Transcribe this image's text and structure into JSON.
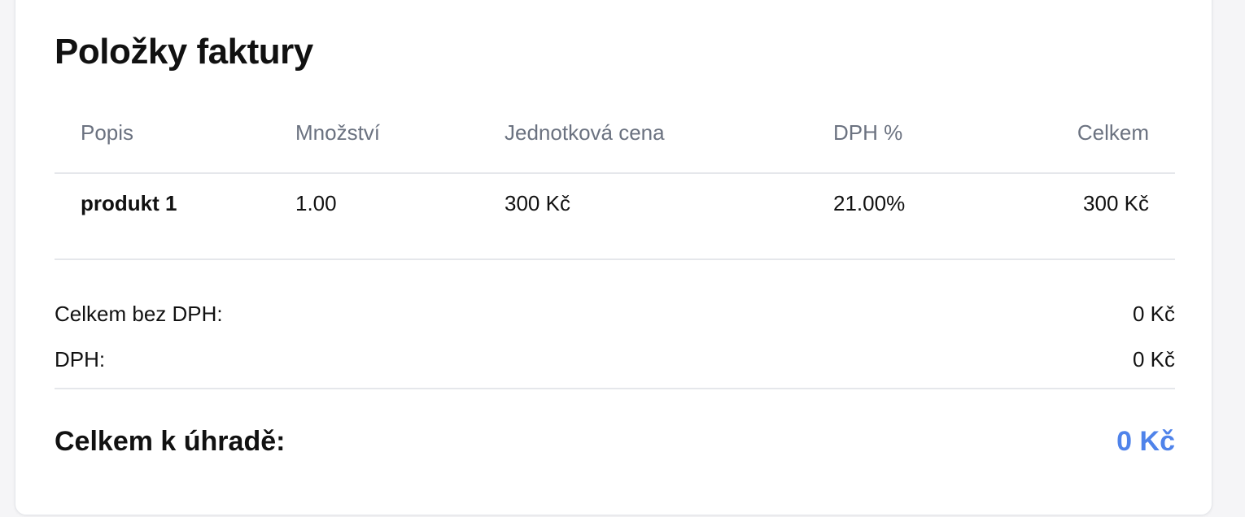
{
  "title": "Položky faktury",
  "table": {
    "headers": {
      "description": "Popis",
      "quantity": "Množství",
      "unit_price": "Jednotková cena",
      "vat_percent": "DPH %",
      "total": "Celkem"
    },
    "rows": [
      {
        "description": "produkt 1",
        "quantity": "1.00",
        "unit_price": "300 Kč",
        "vat_percent": "21.00%",
        "total": "300 Kč"
      }
    ]
  },
  "summary": {
    "net_label": "Celkem bez DPH:",
    "net_value": "0 Kč",
    "vat_label": "DPH:",
    "vat_value": "0 Kč",
    "total_label": "Celkem k úhradě:",
    "total_value": "0 Kč"
  },
  "colors": {
    "accent": "#4f83ea",
    "muted_text": "#6b7280",
    "border": "#e5e7eb"
  }
}
